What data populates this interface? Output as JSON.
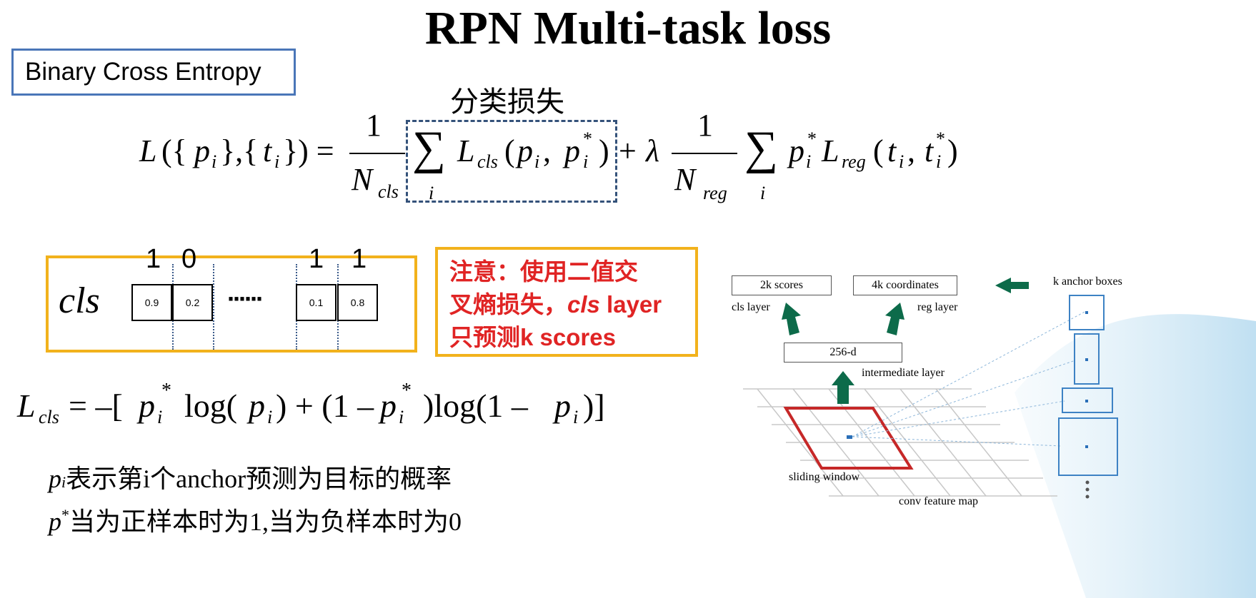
{
  "title": "RPN Multi-task loss",
  "bce_label": "Binary Cross Entropy",
  "formula_annotation": "分类损失",
  "cls_example": {
    "label": "cls",
    "top_labels": [
      "1",
      "0",
      "1",
      "1"
    ],
    "cells": [
      "0.9",
      "0.2",
      "0.1",
      "0.8"
    ],
    "ellipsis": "······"
  },
  "note": {
    "line1": "注意：使用二值交",
    "line2_a": "叉熵损失，",
    "line2_b": "cls",
    "line2_c": " layer",
    "line3": "只预测k scores"
  },
  "explanations": {
    "pi_text": "表示第i个anchor预测为目标的概率",
    "pstar_text": "当为正样本时为1,当为负样本时为0"
  },
  "diagram": {
    "scores_label": "2k scores",
    "coords_label": "4k coordinates",
    "cls_layer": "cls layer",
    "reg_layer": "reg layer",
    "intermediate_box": "256-d",
    "intermediate_layer": "intermediate layer",
    "sliding_window": "sliding window",
    "conv_map": "conv feature map",
    "anchor_boxes": "k anchor boxes",
    "arrow_color": "#0d6b4a",
    "window_color": "#c62828",
    "anchor_color": "#3d82c4"
  }
}
